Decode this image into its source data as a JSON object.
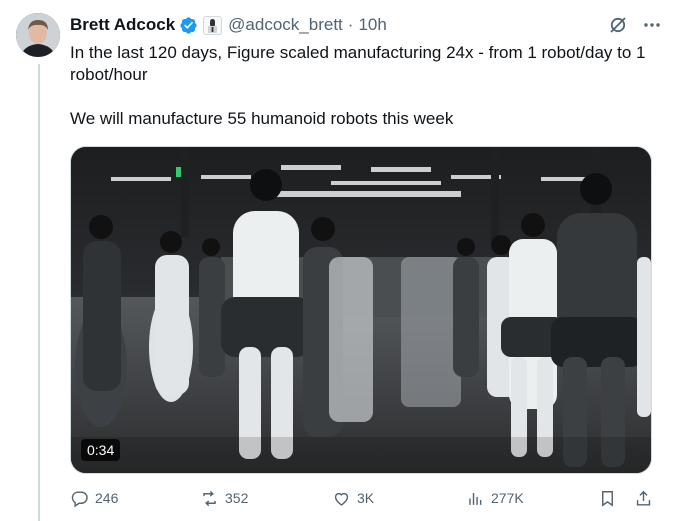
{
  "tweet": {
    "author_name": "Brett Adcock",
    "handle": "@adcock_brett",
    "separator": "·",
    "time": "10h",
    "text_line1": "In the last 120 days, Figure scaled manufacturing 24x - from 1 robot/day to 1 robot/hour",
    "text_line2": "We will manufacture 55 humanoid robots this week",
    "media": {
      "duration": "0:34"
    }
  },
  "actions": {
    "replies": "246",
    "reposts": "352",
    "likes": "3K",
    "views": "277K"
  },
  "colors": {
    "verified": "#1d9bf0",
    "secondary_text": "#536471",
    "primary_text": "#0f1419",
    "thread_line": "#cfd9de"
  },
  "icons": [
    "verified-badge-icon",
    "affiliate-badge-icon",
    "grok-icon",
    "more-icon",
    "reply-icon",
    "repost-icon",
    "like-icon",
    "views-icon",
    "bookmark-icon",
    "share-icon"
  ]
}
